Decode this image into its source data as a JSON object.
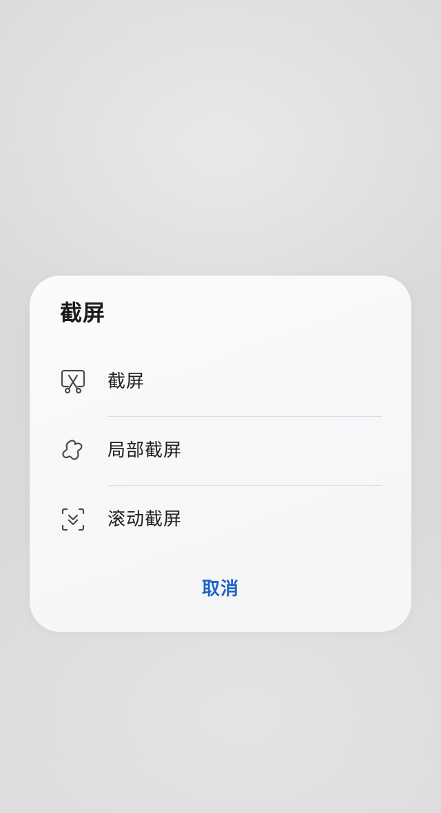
{
  "dialog": {
    "title": "截屏",
    "options": [
      {
        "label": "截屏",
        "icon": "screenshot-scissors-icon"
      },
      {
        "label": "局部截屏",
        "icon": "partial-screenshot-shape-icon"
      },
      {
        "label": "滚动截屏",
        "icon": "scroll-screenshot-icon"
      }
    ],
    "cancel_label": "取消"
  },
  "colors": {
    "accent": "#1f63c5",
    "dialog_background": "#f7f7f8",
    "screen_background": "#dadada",
    "text": "#202020",
    "divider": "#dcdde0"
  }
}
